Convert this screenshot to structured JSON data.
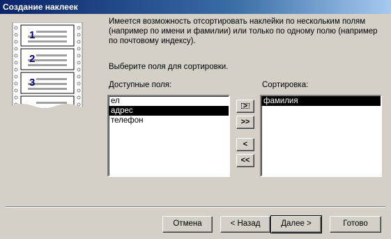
{
  "window": {
    "title": "Создание наклеек"
  },
  "description": "Имеется возможность отсортировать наклейки по нескольким полям (например по имени и фамилии) или только по одному полю (например по почтовому индексу).",
  "prompt": "Выберите поля для сортировки.",
  "available": {
    "label": "Доступные поля:",
    "items": [
      "ел",
      "адрес",
      "телефон"
    ],
    "selected_index": 1
  },
  "sort": {
    "label": "Сортировка:",
    "items": [
      "фамилия"
    ],
    "selected_index": 0
  },
  "move_buttons": {
    "add_one": ">",
    "add_all": ">>",
    "remove_one": "<",
    "remove_all": "<<"
  },
  "illustration": {
    "numbers": [
      "1",
      "2",
      "3"
    ]
  },
  "footer": {
    "cancel": "Отмена",
    "back": "< Назад",
    "next": "Далее >",
    "finish": "Готово"
  }
}
